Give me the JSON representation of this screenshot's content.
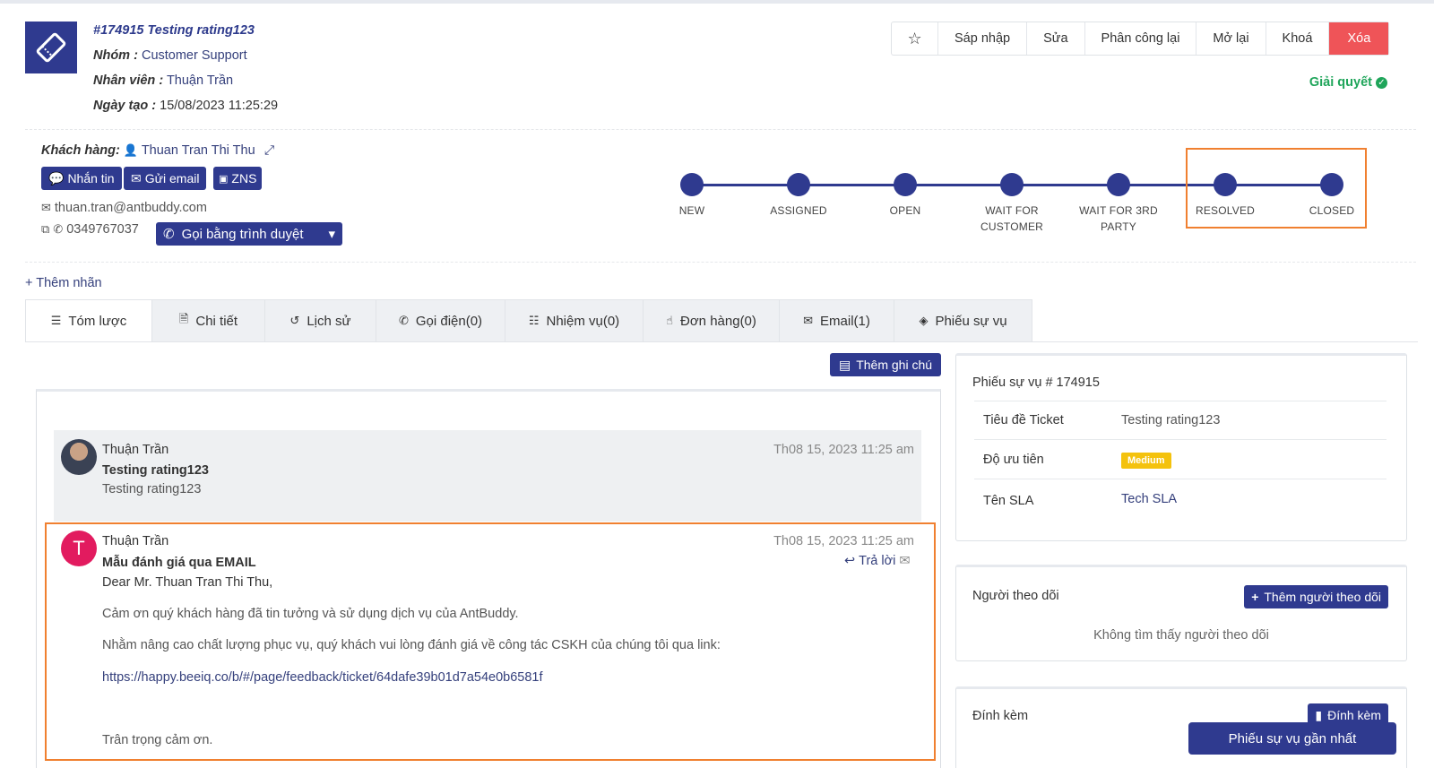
{
  "ticket": {
    "title": "#174915 Testing rating123",
    "group_label": "Nhóm :",
    "group_value": "Customer Support",
    "staff_label": "Nhân viên :",
    "staff_value": "Thuận Trần",
    "created_label": "Ngày tạo :",
    "created_value": "15/08/2023 11:25:29"
  },
  "actions": {
    "star": "☆",
    "merge": "Sáp nhập",
    "edit": "Sửa",
    "reassign": "Phân công lại",
    "reopen": "Mở lại",
    "lock": "Khoá",
    "delete": "Xóa"
  },
  "status_text": "Giải quyết",
  "customer": {
    "label": "Khách hàng:",
    "name": "Thuan Tran Thi Thu",
    "message_btn": "Nhắn tin",
    "email_btn": "Gửi email",
    "zns_btn": "ZNS",
    "email": "thuan.tran@antbuddy.com",
    "phone": "0349767037",
    "call_btn": "Gọi bằng trình duyệt"
  },
  "progress": {
    "steps": [
      "NEW",
      "ASSIGNED",
      "OPEN",
      "WAIT FOR\nCUSTOMER",
      "WAIT FOR 3RD\nPARTY",
      "RESOLVED",
      "CLOSED"
    ]
  },
  "add_tag": "+ Thêm nhãn",
  "tabs": [
    "Tóm lược",
    "Chi tiết",
    "Lịch sử",
    "Gọi điện(0)",
    "Nhiệm vụ(0)",
    "Đơn hàng(0)",
    "Email(1)",
    "Phiếu sự vụ"
  ],
  "add_note": "Thêm ghi chú",
  "messages": [
    {
      "author": "Thuận Trần",
      "date": "Th08 15, 2023 11:25 am",
      "subject": "Testing rating123",
      "body": "Testing rating123"
    },
    {
      "author": "Thuận Trần",
      "avatar_letter": "T",
      "date": "Th08 15, 2023 11:25 am",
      "reply": "Trả lời",
      "subject": "Mẫu đánh giá qua EMAIL",
      "greeting": "Dear Mr.  Thuan Tran Thi Thu,",
      "line1": "Cảm ơn quý khách hàng đã tin tưởng và sử dụng dịch vụ của AntBuddy.",
      "line2": "Nhằm nâng cao chất lượng phục vụ, quý khách vui lòng đánh giá về công tác CSKH của chúng tôi qua link:",
      "link": "https://happy.beeiq.co/b/#/page/feedback/ticket/64dafe39b01d7a54e0b6581f",
      "closing": "Trân trọng cảm ơn."
    }
  ],
  "ticket_panel": {
    "title": "Phiếu sự vụ # 174915",
    "rows": [
      {
        "key": "Tiêu đề Ticket",
        "value": "Testing rating123"
      },
      {
        "key": "Độ ưu tiên",
        "value": "Medium"
      },
      {
        "key": "Tên SLA",
        "value": "Tech SLA"
      }
    ]
  },
  "followers_panel": {
    "title": "Người theo dõi",
    "add_btn": "Thêm người theo dõi",
    "empty": "Không tìm thấy người theo dõi"
  },
  "attach_panel": {
    "title": "Đính kèm",
    "btn": "Đính kèm"
  },
  "recent_btn": "Phiếu sự vụ gần nhất",
  "colors": {
    "primary": "#2f3a8f",
    "danger": "#ef5458",
    "success": "#1fa55a",
    "highlight": "#f08030",
    "badge": "#f4c20d"
  }
}
